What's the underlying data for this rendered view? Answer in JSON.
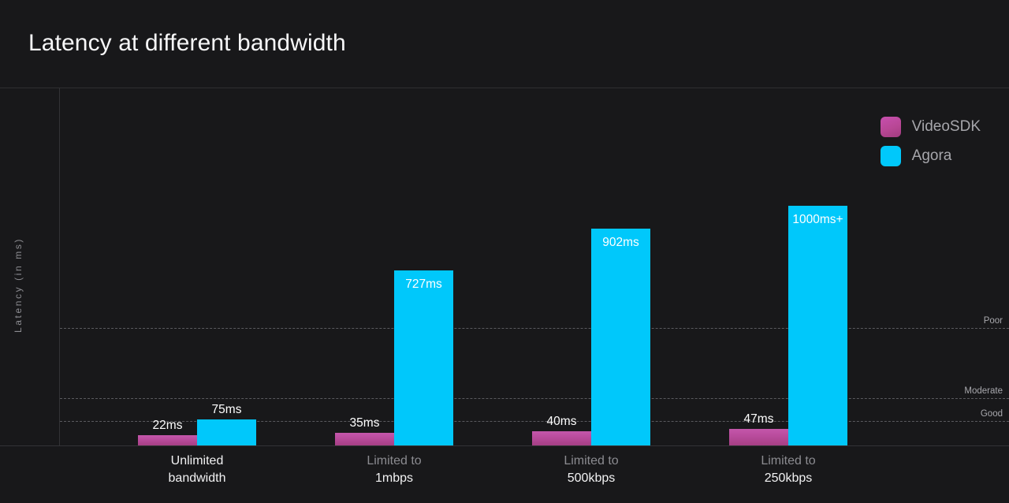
{
  "header": {
    "title": "Latency at different bandwidth"
  },
  "legend": {
    "position": "top-right",
    "items": [
      {
        "label": "VideoSDK",
        "color": "#bb4d9f",
        "swatch_icon": "legend-swatch-square"
      },
      {
        "label": "Agora",
        "color": "#00c8fb",
        "swatch_icon": "legend-swatch-square"
      }
    ]
  },
  "axes": {
    "ylabel": "Latency (in ms)"
  },
  "thresholds": [
    {
      "label": "Poor",
      "y_ms": 570
    },
    {
      "label": "Moderate",
      "y_ms": 190
    },
    {
      "label": "Good",
      "y_ms": 100
    }
  ],
  "groups": [
    {
      "line1": "Unlimited",
      "line2": "bandwidth",
      "style": "bright"
    },
    {
      "line1": "Limited to",
      "line2": "1mbps",
      "style": "dim"
    },
    {
      "line1": "Limited to",
      "line2": "500kbps",
      "style": "dim"
    },
    {
      "line1": "Limited to",
      "line2": "250kbps",
      "style": "dim"
    }
  ],
  "bar_labels": {
    "g0_videosdk": "22ms",
    "g0_agora": "75ms",
    "g1_videosdk": "35ms",
    "g1_agora": "727ms",
    "g2_videosdk": "40ms",
    "g2_agora": "902ms",
    "g3_videosdk": "47ms",
    "g3_agora": "1000ms+"
  },
  "chart_data": {
    "type": "bar",
    "title": "Latency at different bandwidth",
    "xlabel": "",
    "ylabel": "Latency (in ms)",
    "categories": [
      "Unlimited bandwidth",
      "Limited to 1mbps",
      "Limited to 500kbps",
      "Limited to 250kbps"
    ],
    "series": [
      {
        "name": "VideoSDK",
        "color": "#bb4d9f",
        "values": [
          22,
          35,
          40,
          47
        ],
        "data_labels": [
          "22ms",
          "35ms",
          "40ms",
          "47ms"
        ]
      },
      {
        "name": "Agora",
        "color": "#00c8fb",
        "values": [
          75,
          727,
          902,
          1000
        ],
        "data_labels": [
          "75ms",
          "727ms",
          "902ms",
          "1000ms+"
        ]
      }
    ],
    "ylim": [
      0,
      1040
    ],
    "grid": true,
    "grid_style": "dashed-horizontal",
    "gridlines": [
      {
        "label": "Poor",
        "value": 570
      },
      {
        "label": "Moderate",
        "value": 190
      },
      {
        "label": "Good",
        "value": 100
      }
    ],
    "legend_position": "top-right",
    "units": "ms",
    "background": "#18181a"
  }
}
